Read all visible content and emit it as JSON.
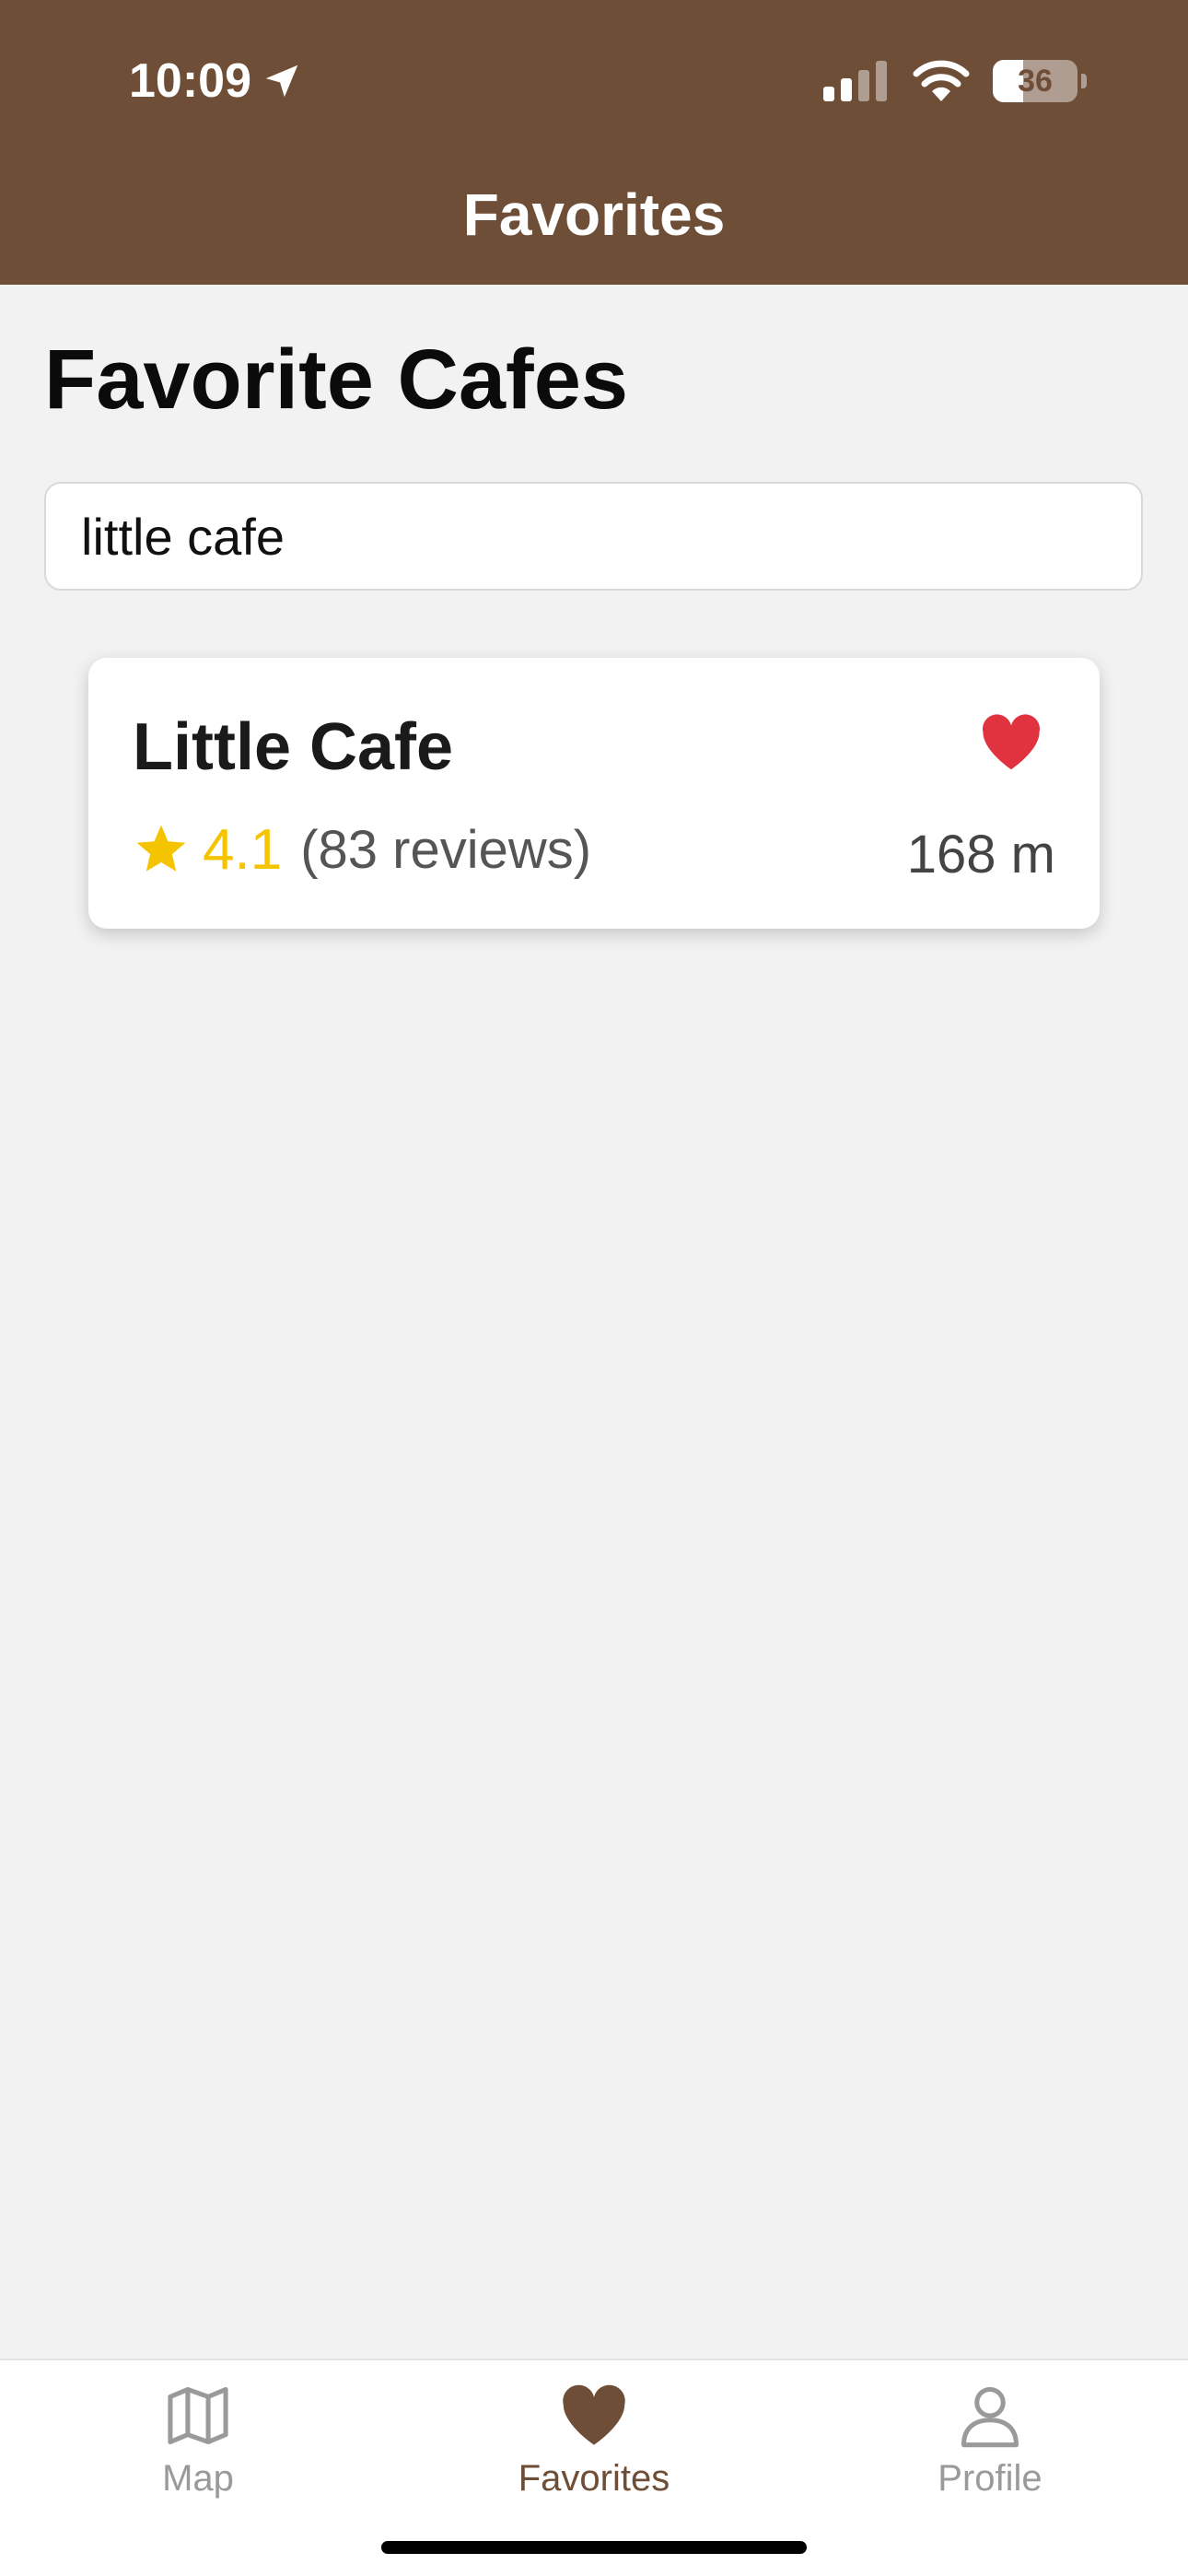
{
  "status_bar": {
    "time": "10:09",
    "battery_percent": "36"
  },
  "nav": {
    "title": "Favorites"
  },
  "page": {
    "title": "Favorite Cafes"
  },
  "search": {
    "value": "little cafe",
    "placeholder": ""
  },
  "cafes": [
    {
      "name": "Little Cafe",
      "rating": "4.1",
      "reviews": "(83 reviews)",
      "distance": "168 m",
      "favorited": true
    }
  ],
  "tabs": [
    {
      "label": "Map",
      "icon": "map-icon",
      "active": false
    },
    {
      "label": "Favorites",
      "icon": "heart-icon",
      "active": true
    },
    {
      "label": "Profile",
      "icon": "person-icon",
      "active": false
    }
  ],
  "colors": {
    "brand": "#6f4e37",
    "heart": "#e0333f",
    "star": "#f5c400",
    "inactive_tab": "#9a9a9a",
    "background": "#f2f2f2"
  }
}
